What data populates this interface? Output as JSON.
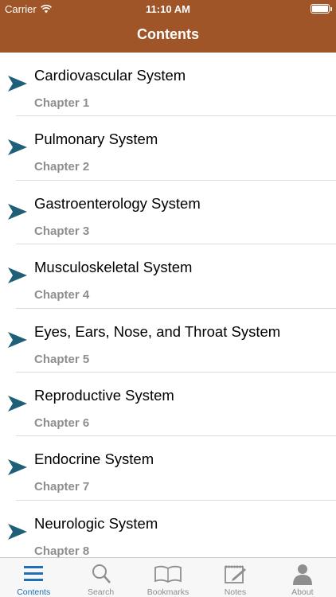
{
  "status_bar": {
    "carrier": "Carrier",
    "time": "11:10 AM",
    "battery_level": 1.0
  },
  "nav": {
    "title": "Contents"
  },
  "chapters": [
    {
      "title": "Cardiovascular System",
      "subtitle": "Chapter 1"
    },
    {
      "title": "Pulmonary System",
      "subtitle": "Chapter 2"
    },
    {
      "title": "Gastroenterology System",
      "subtitle": "Chapter 3"
    },
    {
      "title": "Musculoskeletal System",
      "subtitle": "Chapter 4"
    },
    {
      "title": "Eyes, Ears, Nose, and Throat System",
      "subtitle": "Chapter 5"
    },
    {
      "title": "Reproductive System",
      "subtitle": "Chapter 6"
    },
    {
      "title": "Endocrine System",
      "subtitle": "Chapter 7"
    },
    {
      "title": "Neurologic System",
      "subtitle": "Chapter 8"
    }
  ],
  "tabbar": {
    "tabs": [
      {
        "label": "Contents",
        "icon": "list-icon",
        "active": true
      },
      {
        "label": "Search",
        "icon": "search-icon",
        "active": false
      },
      {
        "label": "Bookmarks",
        "icon": "book-icon",
        "active": false
      },
      {
        "label": "Notes",
        "icon": "notes-icon",
        "active": false
      },
      {
        "label": "About",
        "icon": "person-icon",
        "active": false
      }
    ]
  },
  "colors": {
    "header_bg": "#a05528",
    "arrow": "#1f5f78",
    "tab_active": "#1e6fb6",
    "tab_inactive": "#8e8e8e",
    "subtitle": "#8e8e8e"
  }
}
